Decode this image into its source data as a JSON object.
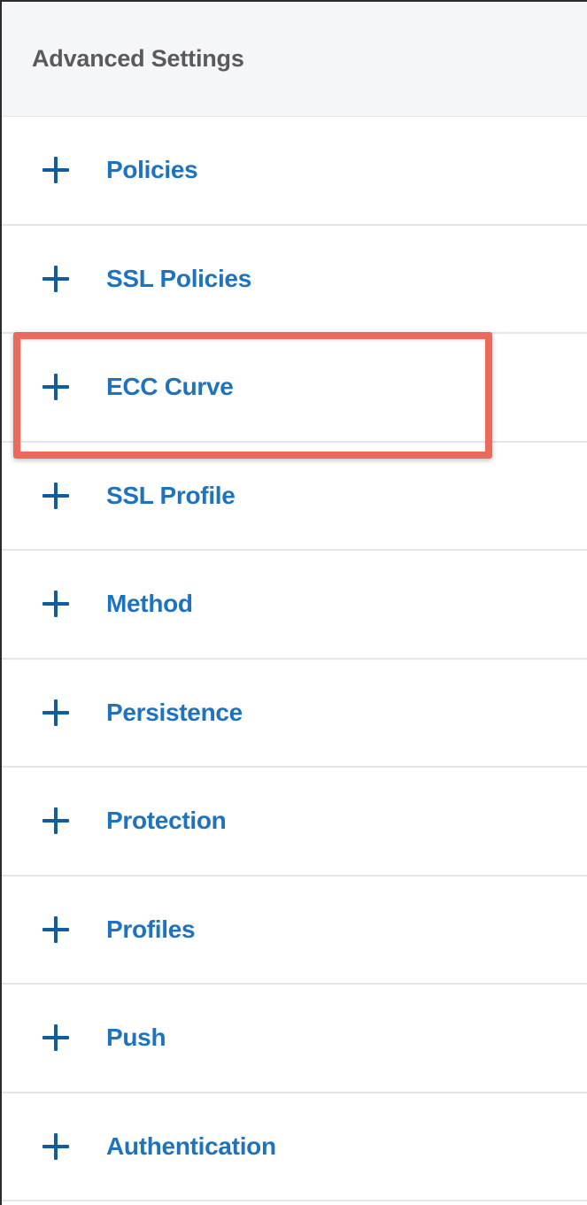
{
  "panel": {
    "title": "Advanced Settings"
  },
  "items": [
    {
      "label": "Policies",
      "icon": "plus-icon"
    },
    {
      "label": "SSL Policies",
      "icon": "plus-icon"
    },
    {
      "label": "ECC Curve",
      "icon": "plus-icon",
      "highlighted": true
    },
    {
      "label": "SSL Profile",
      "icon": "plus-icon"
    },
    {
      "label": "Method",
      "icon": "plus-icon"
    },
    {
      "label": "Persistence",
      "icon": "plus-icon"
    },
    {
      "label": "Protection",
      "icon": "plus-icon"
    },
    {
      "label": "Profiles",
      "icon": "plus-icon"
    },
    {
      "label": "Push",
      "icon": "plus-icon"
    },
    {
      "label": "Authentication",
      "icon": "plus-icon"
    }
  ],
  "colors": {
    "link": "#1e73be",
    "icon": "#0f5d9c",
    "highlight": "#ec6a5c",
    "header_bg": "#f4f6f8"
  }
}
